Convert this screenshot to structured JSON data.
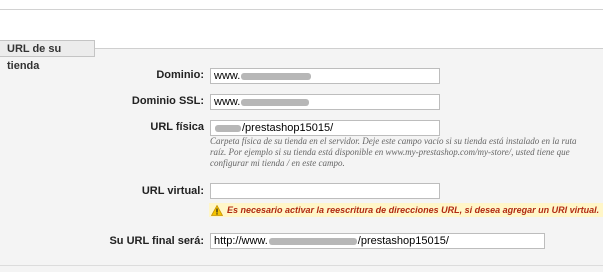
{
  "section": {
    "title": "URL de su tienda"
  },
  "fields": {
    "domain": {
      "label": "Dominio:",
      "value": "www."
    },
    "domain_ssl": {
      "label": "Dominio SSL:",
      "value": "www."
    },
    "physical": {
      "label": "URL física",
      "value": "/prestashop15015/"
    },
    "virtual": {
      "label": "URL virtual:",
      "value": ""
    },
    "final": {
      "label": "Su URL final será:",
      "prefix": "http://www.",
      "suffix": "/prestashop15015/"
    }
  },
  "help": {
    "line1": "Carpeta física de su tienda en el servidor. Deje este campo vacío si su tienda está instalado en la ruta",
    "line2": "raíz. Por ejemplo si su tienda está disponible en www.my-prestashop.com/my-store/, usted tiene que",
    "line3": "configurar mi tienda / en este campo."
  },
  "warning": {
    "icon": "warning-icon",
    "text": "Es necesario activar la reescritura de direcciones URL, si desea agregar un URI virtual."
  },
  "colors": {
    "warning_bg": "#fff6c8",
    "warning_text": "#b12a11",
    "panel_bg": "#f4f4f4"
  }
}
